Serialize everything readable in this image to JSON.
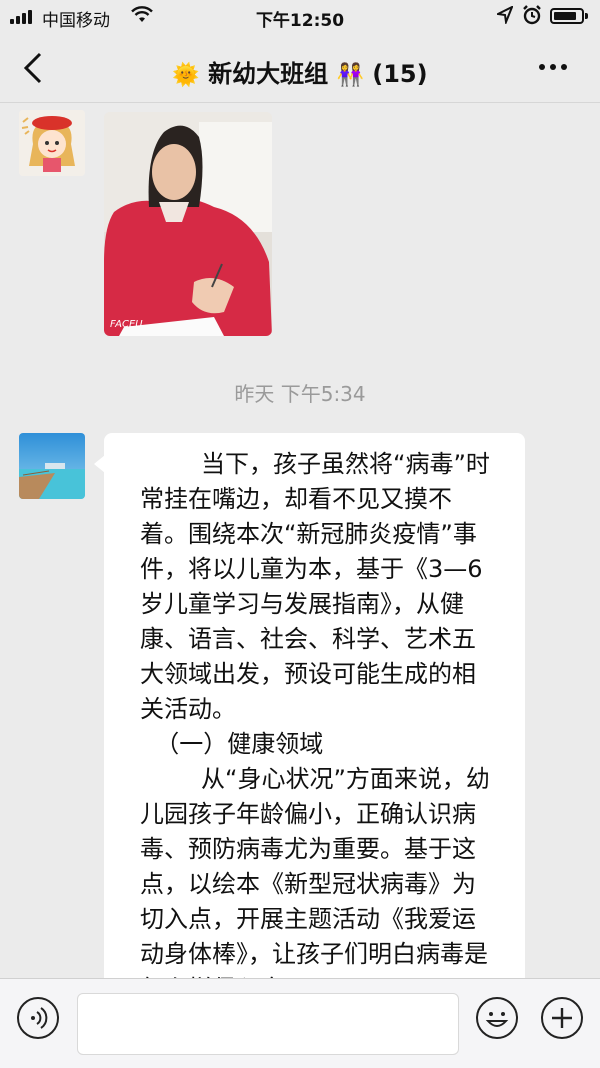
{
  "status_bar": {
    "carrier": "中国移动",
    "time": "下午12:50",
    "icons": [
      "signal-icon",
      "wifi-icon",
      "location-icon",
      "alarm-icon",
      "battery-icon"
    ]
  },
  "nav": {
    "title_emoji_left": "🌞",
    "title": "新幼大班组",
    "title_emoji_right": "👭",
    "member_count": "(15)",
    "icons": [
      "back-icon",
      "more-icon"
    ]
  },
  "photo": {
    "watermark": "FACEU"
  },
  "timestamp": "昨天  下午5:34",
  "message": {
    "text": "        当下，孩子虽然将“病毒”时常挂在嘴边，却看不见又摸不着。围绕本次“新冠肺炎疫情”事件，将以儿童为本，基于《3—6岁儿童学习与发展指南》，从健康、语言、社会、科学、艺术五大领域出发，预设可能生成的相关活动。\n  （一）健康领域\n        从“身心状况”方面来说，幼儿园孩子年龄偏小，正确认识病毒、预防病毒尤为重要。基于这点，以绘本《新型冠状病毒》为切入点，开展主题活动《我爱运动身体棒》，让孩子们明白病毒是怎么样侵入身"
  },
  "input_bar": {
    "value": "",
    "icons": [
      "voice-icon",
      "emoji-icon",
      "plus-icon"
    ]
  },
  "colors": {
    "background": "#ebebeb",
    "bubble": "#ffffff",
    "timestamp": "#9a9a9a"
  }
}
